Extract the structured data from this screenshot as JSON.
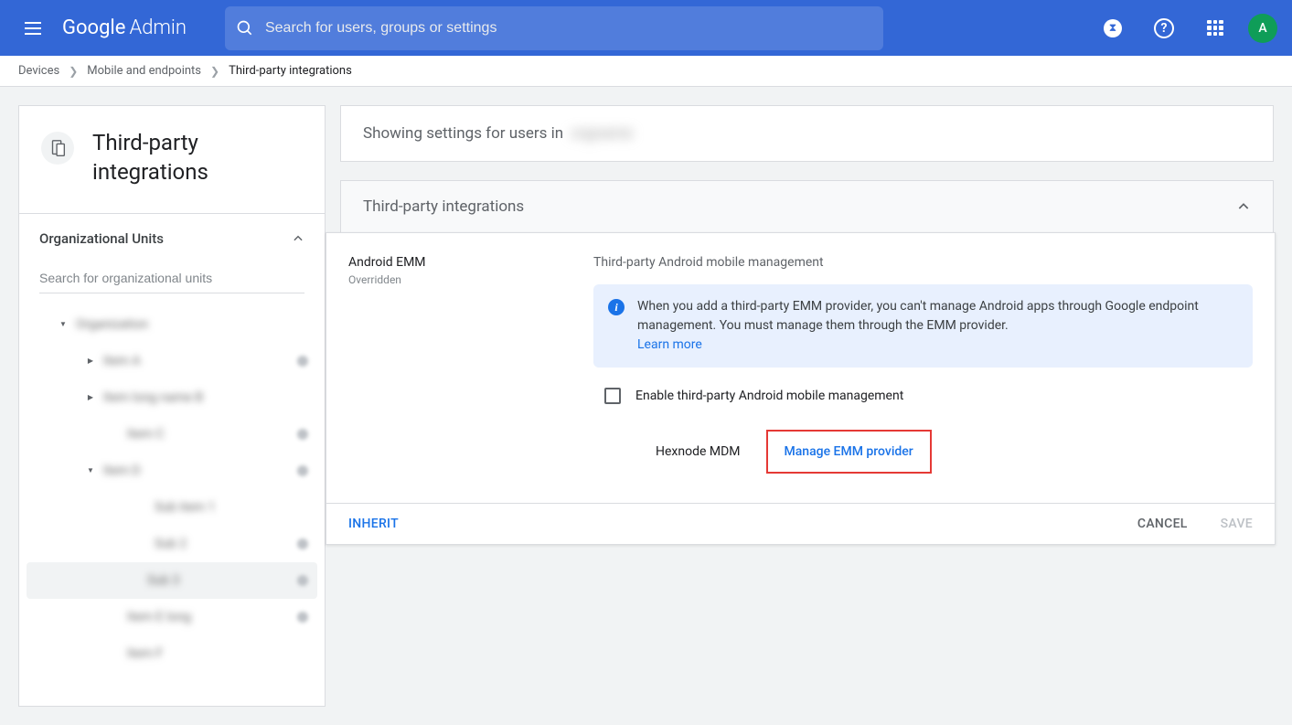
{
  "header": {
    "logo_google": "Google",
    "logo_admin": "Admin",
    "search_placeholder": "Search for users, groups or settings",
    "avatar_letter": "A"
  },
  "breadcrumb": {
    "items": [
      "Devices",
      "Mobile and endpoints"
    ],
    "current": "Third-party integrations"
  },
  "sidebar": {
    "title": "Third-party integrations",
    "ou_title": "Organizational Units",
    "ou_search_placeholder": "Search for organizational units",
    "tree": [
      {
        "indent": 34,
        "tri": "down",
        "label": "Organization",
        "dot": false
      },
      {
        "indent": 64,
        "tri": "right",
        "label": "Item A",
        "dot": true
      },
      {
        "indent": 64,
        "tri": "right",
        "label": "Item long name B",
        "dot": false
      },
      {
        "indent": 90,
        "tri": "",
        "label": "Item C",
        "dot": true
      },
      {
        "indent": 64,
        "tri": "down",
        "label": "Item D",
        "dot": true
      },
      {
        "indent": 120,
        "tri": "",
        "label": "Sub item 1",
        "dot": false
      },
      {
        "indent": 120,
        "tri": "",
        "label": "Sub 2",
        "dot": true
      },
      {
        "indent": 112,
        "tri": "",
        "label": "Sub 3",
        "dot": true,
        "selected": true
      },
      {
        "indent": 90,
        "tri": "",
        "label": "Item E long",
        "dot": true
      },
      {
        "indent": 90,
        "tri": "",
        "label": "Item F",
        "dot": false
      }
    ]
  },
  "main": {
    "banner_prefix": "Showing settings for users in",
    "banner_org": "orgname",
    "panel_title": "Third-party integrations",
    "section": {
      "name": "Android EMM",
      "sub": "Overridden",
      "right_title": "Third-party Android mobile management",
      "info_text": "When you add a third-party EMM provider, you can't manage Android apps through Google endpoint management. You must manage them through the EMM provider.",
      "info_link": "Learn more",
      "checkbox_label": "Enable third-party Android mobile management",
      "provider_name": "Hexnode MDM",
      "manage_link": "Manage EMM provider"
    },
    "footer": {
      "inherit": "INHERIT",
      "cancel": "CANCEL",
      "save": "SAVE"
    }
  }
}
